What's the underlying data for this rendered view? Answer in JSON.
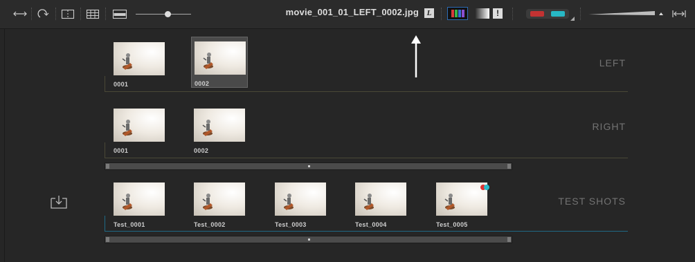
{
  "toolbar": {
    "filename": "movie_001_01_LEFT_0002.jpg",
    "eye_label": "L",
    "exposure_label": "!",
    "slider_level": 0.55,
    "icons": [
      "swap-horizontal-icon",
      "rotate-icon",
      "single-view-icon",
      "grid-view-icon",
      "filmstrip-icon",
      "color-channels-icon",
      "gradient-icon",
      "exposure-warning-icon",
      "anaglyph-glasses-icon",
      "zoom-icon",
      "fit-width-icon"
    ]
  },
  "rows": [
    {
      "label": "LEFT",
      "thumbs": [
        {
          "label": "0001",
          "selected": false
        },
        {
          "label": "0002",
          "selected": true
        }
      ]
    },
    {
      "label": "RIGHT",
      "thumbs": [
        {
          "label": "0001",
          "selected": false
        },
        {
          "label": "0002",
          "selected": false
        }
      ]
    },
    {
      "label": "TEST SHOTS",
      "thumbs": [
        {
          "label": "Test_0001"
        },
        {
          "label": "Test_0002"
        },
        {
          "label": "Test_0003"
        },
        {
          "label": "Test_0004"
        },
        {
          "label": "Test_0005",
          "badge": true
        }
      ]
    }
  ],
  "colors": {
    "background": "#262626",
    "toolbar": "#2b2b2b",
    "accent_blue": "#2d6cb5",
    "row_line_left_right": "#4a4836",
    "row_line_test": "#1f6a86",
    "label_gray": "#737373"
  }
}
